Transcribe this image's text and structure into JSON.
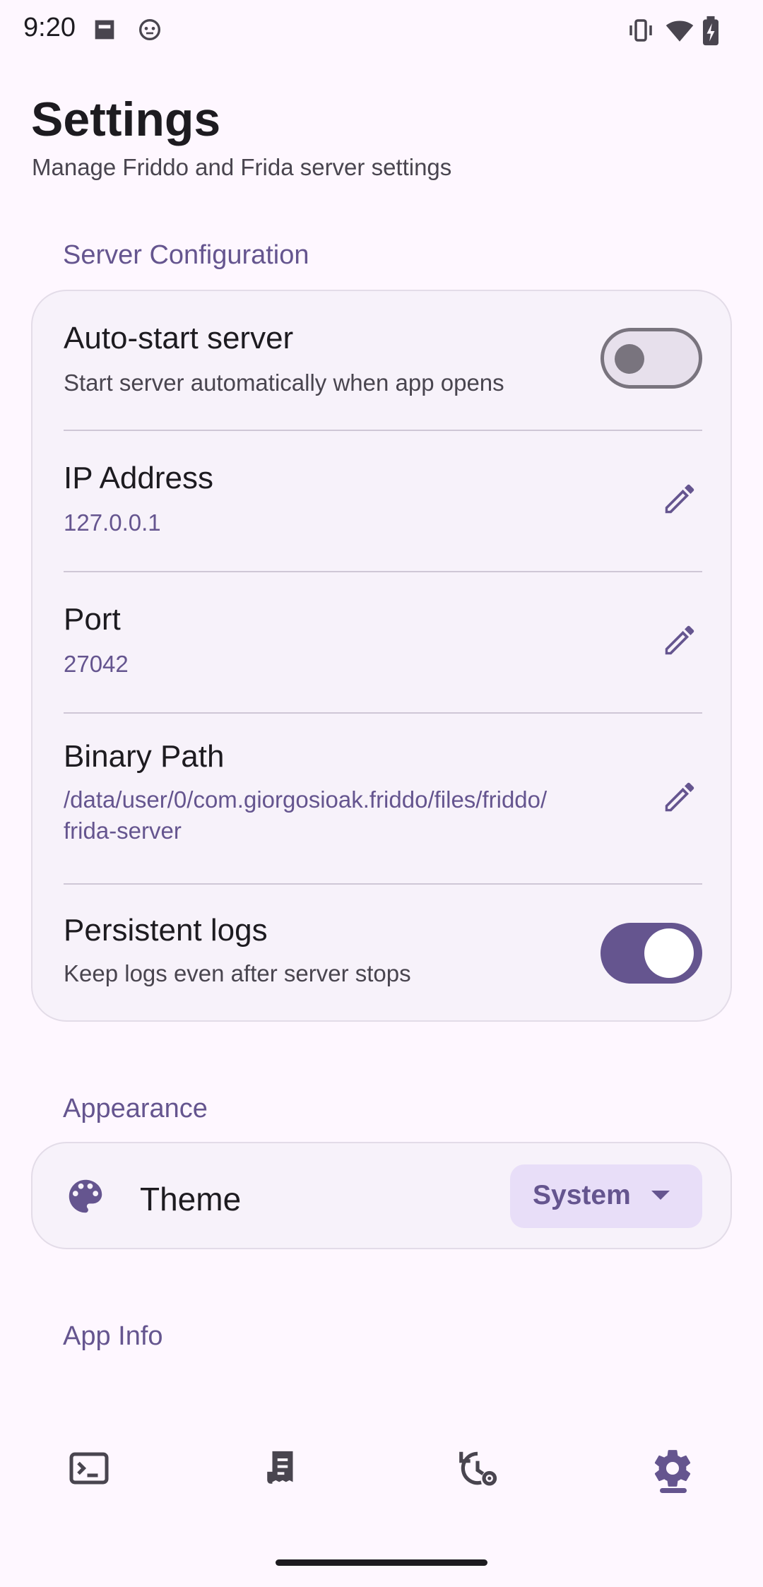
{
  "status_bar": {
    "time": "9:20",
    "left_icons": [
      "sim-card-icon",
      "monkey-icon"
    ],
    "right_icons": [
      "vibrate-icon",
      "wifi-icon",
      "battery-charging-icon"
    ]
  },
  "header": {
    "title": "Settings",
    "subtitle": "Manage Friddo and Frida server settings"
  },
  "server_section": {
    "title": "Server Configuration",
    "auto_start": {
      "title": "Auto-start server",
      "subtitle": "Start server automatically when app opens",
      "enabled": false
    },
    "ip": {
      "title": "IP Address",
      "value": "127.0.0.1"
    },
    "port": {
      "title": "Port",
      "value": "27042"
    },
    "binary": {
      "title": "Binary Path",
      "value_line1": "/data/user/0/com.giorgosioak.friddo/files/friddo/",
      "value_line2": "frida-server"
    },
    "persistent_logs": {
      "title": "Persistent logs",
      "subtitle": "Keep logs even after server stops",
      "enabled": true
    }
  },
  "appearance_section": {
    "title": "Appearance",
    "theme": {
      "title": "Theme",
      "selected": "System",
      "icon": "palette-icon"
    }
  },
  "app_info_section": {
    "title": "App Info"
  },
  "bottom_nav": {
    "items": [
      {
        "name": "terminal",
        "icon": "terminal-icon"
      },
      {
        "name": "logs",
        "icon": "receipt-icon"
      },
      {
        "name": "history",
        "icon": "history-settings-icon"
      },
      {
        "name": "settings",
        "icon": "gear-icon",
        "selected": true
      }
    ]
  },
  "colors": {
    "accent": "#65558F",
    "background": "#FEF7FF",
    "card": "#F7F2FA"
  }
}
